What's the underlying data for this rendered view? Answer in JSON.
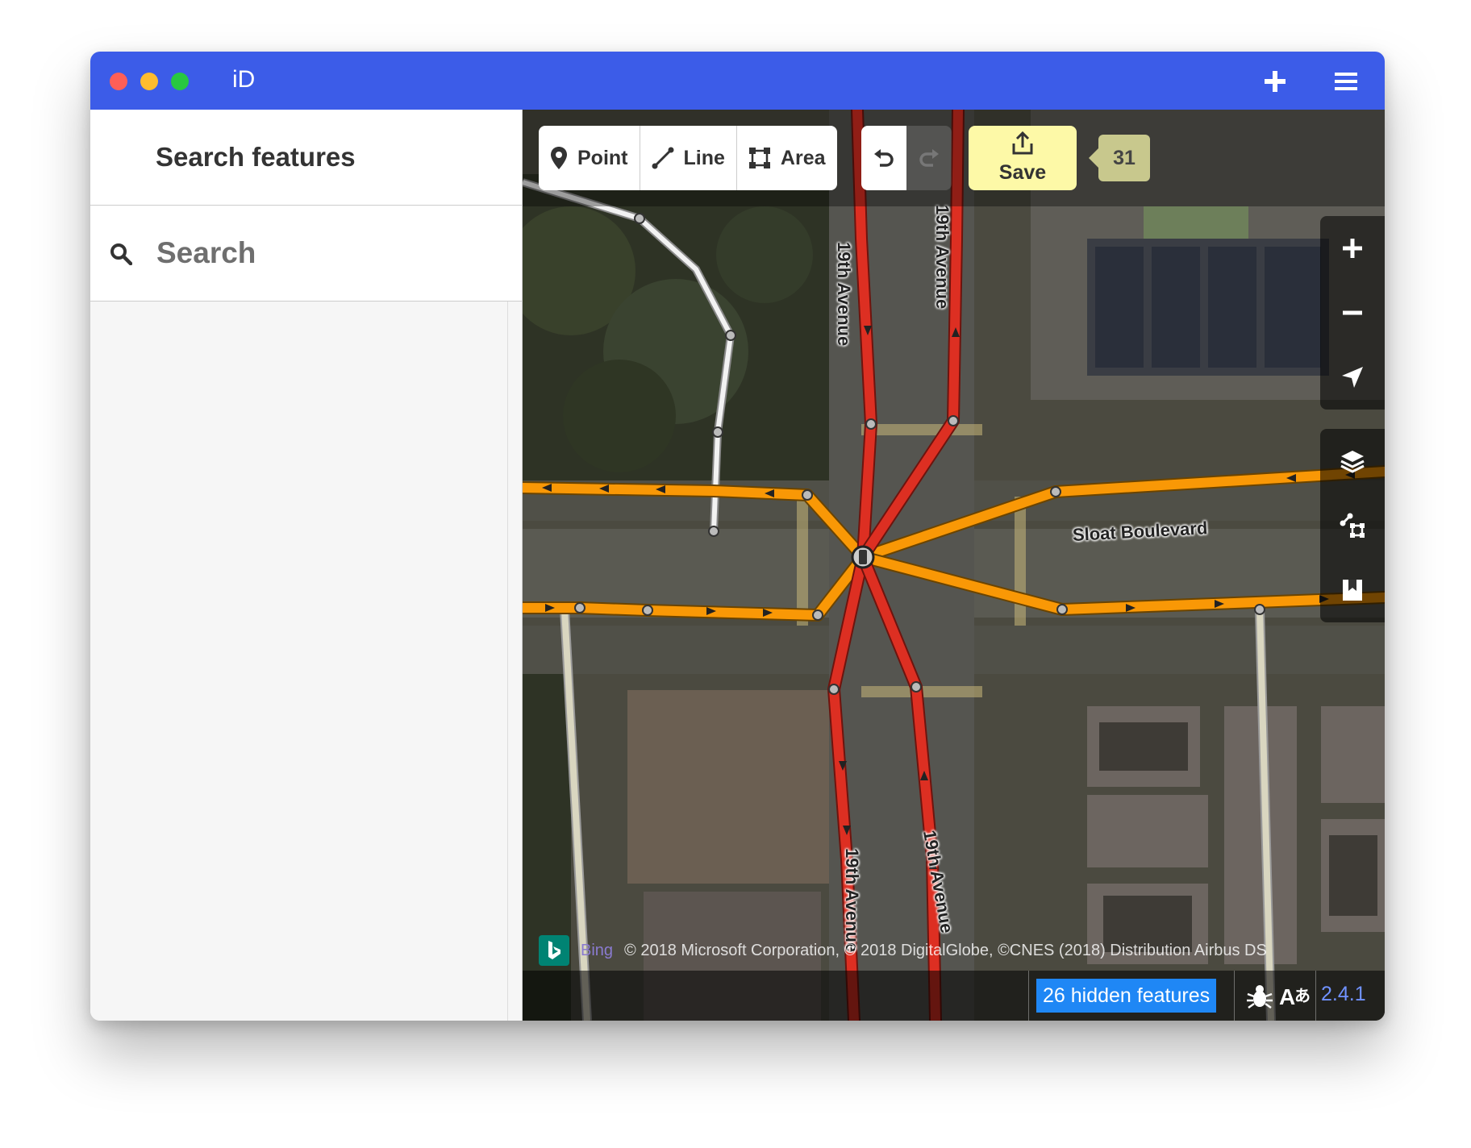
{
  "window": {
    "title": "iD",
    "colors": {
      "titlebar": "#3c5ce8",
      "close": "#fe5f57",
      "minimize": "#febc2e",
      "zoom": "#28c840"
    }
  },
  "titlebar": {
    "add_icon": "plus-icon",
    "menu_icon": "hamburger-menu-icon"
  },
  "sidebar": {
    "title": "Search features",
    "search": {
      "placeholder": "Search",
      "value": ""
    }
  },
  "toolbar": {
    "modes": [
      {
        "label": "Point",
        "icon": "point-pin-icon"
      },
      {
        "label": "Line",
        "icon": "line-icon"
      },
      {
        "label": "Area",
        "icon": "area-icon"
      }
    ],
    "undo_icon": "undo-icon",
    "redo_icon": "redo-icon",
    "save": {
      "label": "Save",
      "icon": "upload-icon",
      "color": "#fdf9a7"
    },
    "edit_count": "31"
  },
  "map": {
    "road_labels": {
      "sloat": "Sloat Boulevard",
      "nineteenth_a": "19th Avenue",
      "nineteenth_b": "19th Avenue",
      "nineteenth_c": "19th Avenue",
      "nineteenth_d": "19th Avenue"
    },
    "controls": {
      "zoom_in": "zoom-in-icon",
      "zoom_out": "zoom-out-icon",
      "geolocate": "geolocate-icon",
      "background": "layers-icon",
      "map_data": "map-data-icon",
      "issues": "issues-icon"
    },
    "road_colors": {
      "primary": "#f99806",
      "trunk": "#dd2f22",
      "path": "#f2f2f2"
    }
  },
  "attribution": {
    "provider": "Bing",
    "text": "© 2018 Microsoft Corporation, © 2018 DigitalGlobe, ©CNES (2018) Distribution Airbus DS"
  },
  "footer": {
    "hidden_features": "26 hidden features",
    "version": "2.4.1"
  }
}
